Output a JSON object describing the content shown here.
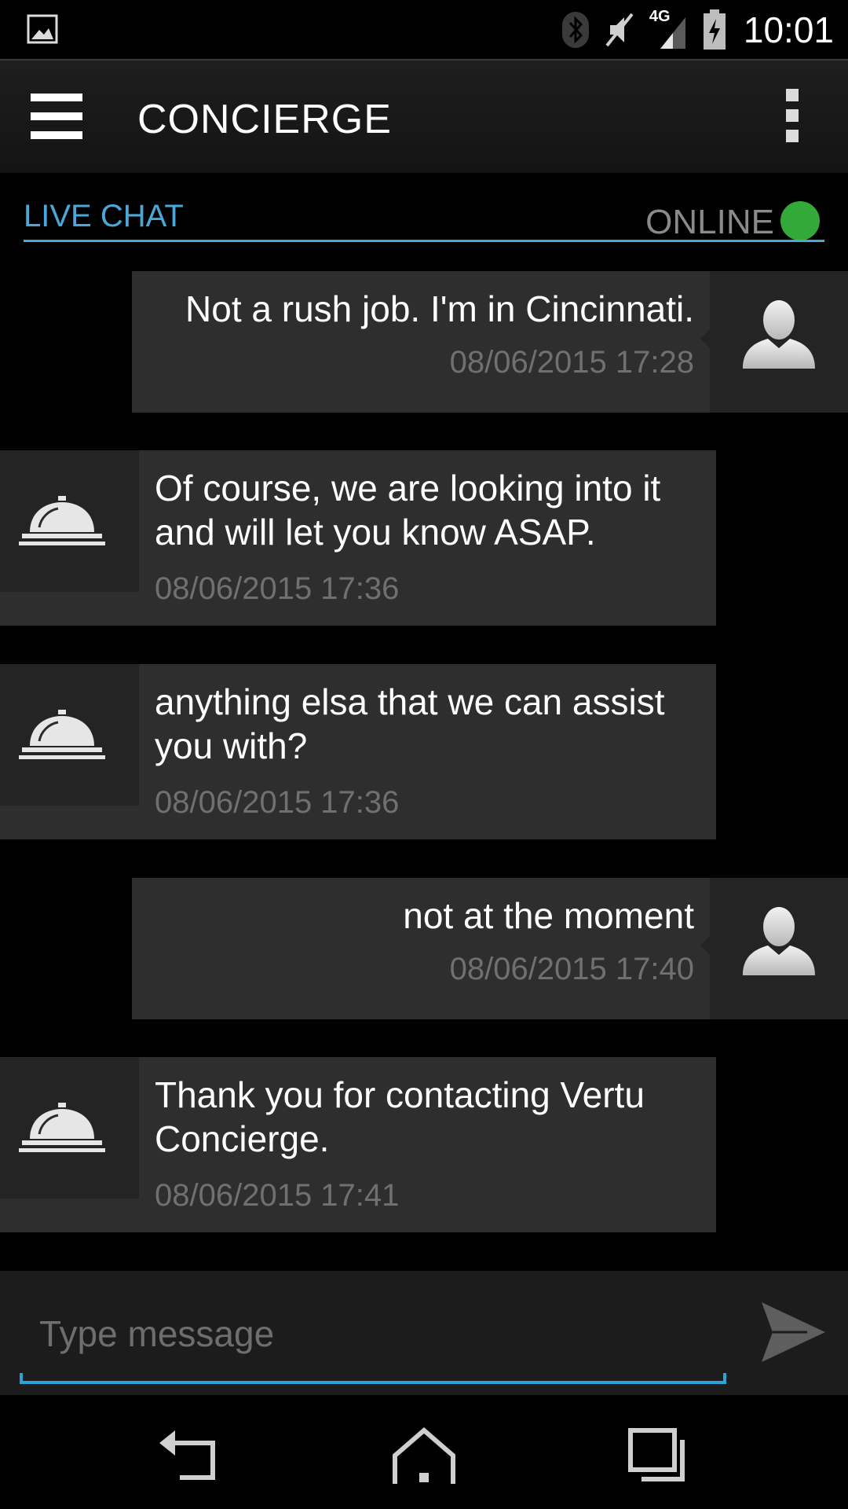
{
  "status_bar": {
    "time": "10:01",
    "network": "4G"
  },
  "header": {
    "title": "CONCIERGE"
  },
  "chat_header": {
    "label": "LIVE CHAT",
    "status": "ONLINE",
    "status_color": "#33a93a"
  },
  "messages": [
    {
      "sender": "user",
      "text": "Not a rush job. I'm in Cincinnati.",
      "time": "08/06/2015 17:28"
    },
    {
      "sender": "agent",
      "text": "Of course, we are looking into it and will let you know ASAP.",
      "time": "08/06/2015 17:36"
    },
    {
      "sender": "agent",
      "text": "anything elsa that we can assist you with?",
      "time": "08/06/2015 17:36"
    },
    {
      "sender": "user",
      "text": "not at the moment",
      "time": "08/06/2015 17:40"
    },
    {
      "sender": "agent",
      "text": "Thank you for contacting Vertu Concierge.",
      "time": "08/06/2015 17:41"
    }
  ],
  "composer": {
    "placeholder": "Type message"
  },
  "colors": {
    "accent": "#4aa7d8",
    "bubble": "#2e2e2e",
    "background": "#000000"
  }
}
